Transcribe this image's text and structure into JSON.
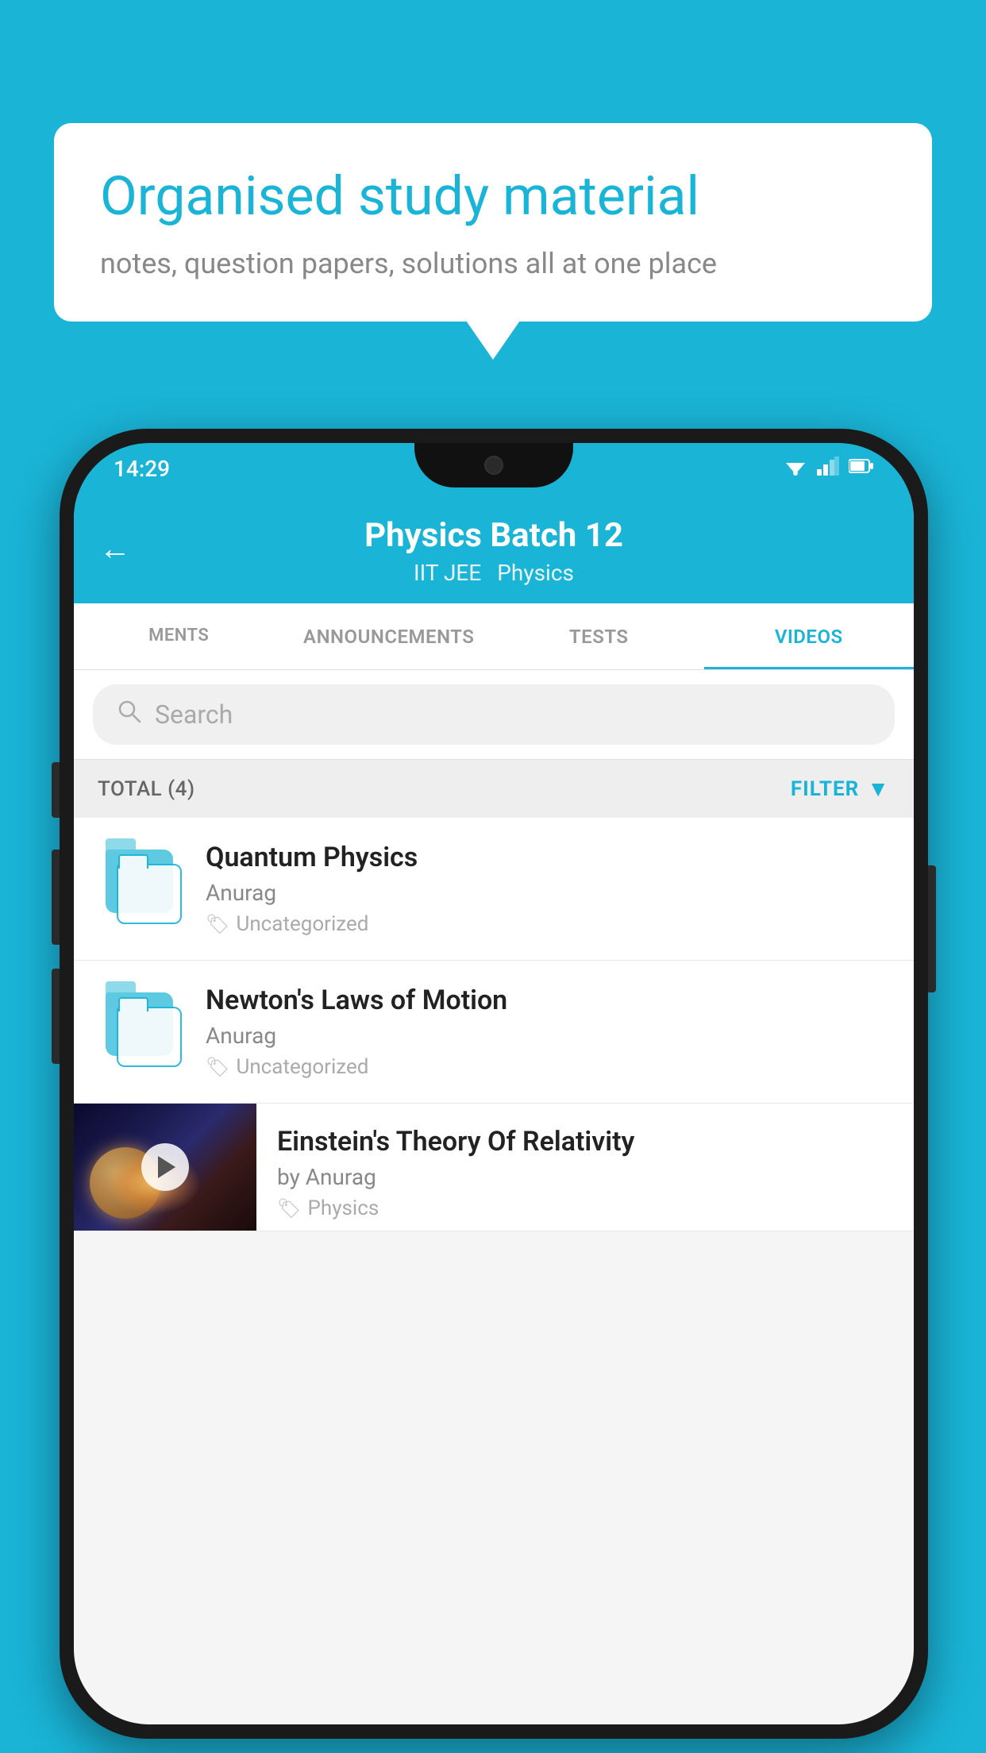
{
  "background_color": "#1ab4d7",
  "speech_bubble": {
    "title": "Organised study material",
    "subtitle": "notes, question papers, solutions all at one place"
  },
  "status_bar": {
    "time": "14:29",
    "icons": [
      "wifi",
      "signal",
      "battery"
    ]
  },
  "app_bar": {
    "title": "Physics Batch 12",
    "subtitle1": "IIT JEE",
    "subtitle2": "Physics",
    "back_label": "←"
  },
  "tabs": [
    {
      "label": "MENTS",
      "active": false
    },
    {
      "label": "ANNOUNCEMENTS",
      "active": false
    },
    {
      "label": "TESTS",
      "active": false
    },
    {
      "label": "VIDEOS",
      "active": true
    }
  ],
  "search": {
    "placeholder": "Search"
  },
  "filter_bar": {
    "total_label": "TOTAL (4)",
    "filter_label": "FILTER"
  },
  "videos": [
    {
      "title": "Quantum Physics",
      "author": "Anurag",
      "tag": "Uncategorized",
      "type": "folder"
    },
    {
      "title": "Newton's Laws of Motion",
      "author": "Anurag",
      "tag": "Uncategorized",
      "type": "folder"
    },
    {
      "title": "Einstein's Theory Of Relativity",
      "author": "by Anurag",
      "tag": "Physics",
      "type": "video"
    }
  ]
}
